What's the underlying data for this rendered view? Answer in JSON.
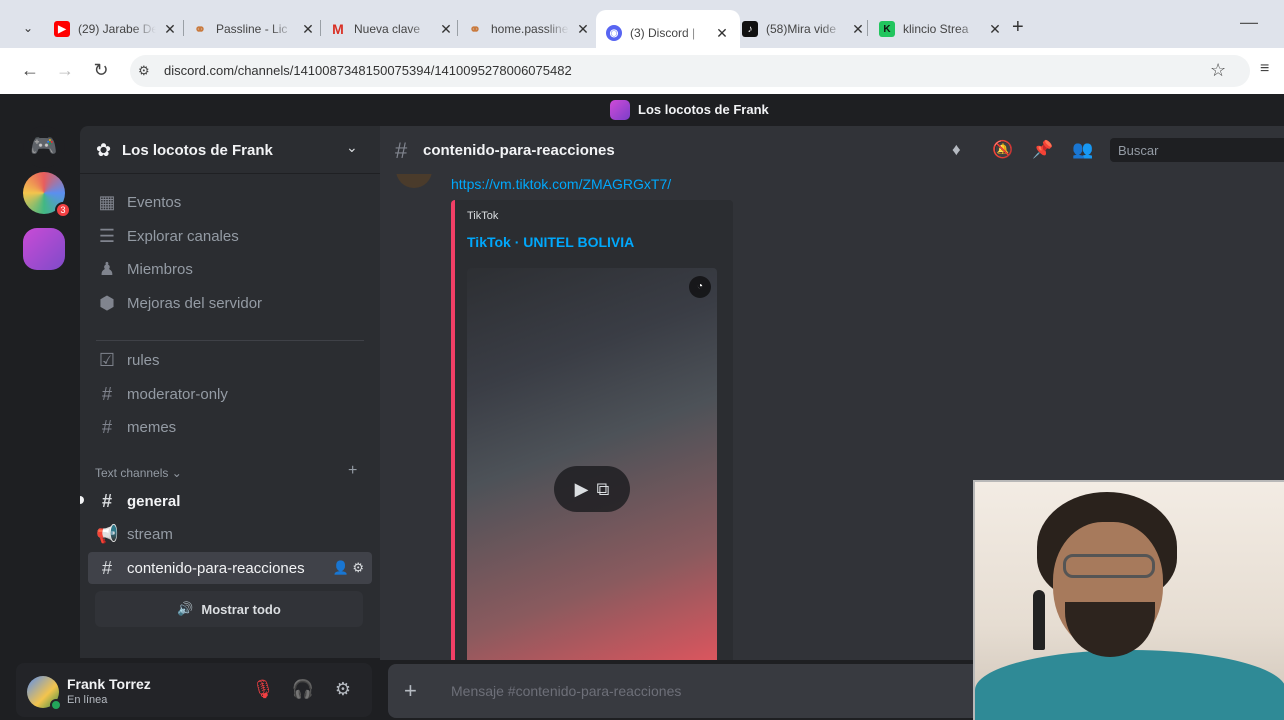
{
  "browser": {
    "tabs": [
      {
        "title": "(29) Jarabe De",
        "fav_color": "#ff0000",
        "fav_glyph": "▶"
      },
      {
        "title": "Passline - Lic",
        "fav_color": "#e8a060",
        "fav_glyph": "⚭"
      },
      {
        "title": "Nueva clave",
        "fav_color": "#ffffff",
        "fav_glyph": "M"
      },
      {
        "title": "home.passline",
        "fav_color": "#e8a060",
        "fav_glyph": "⚭"
      },
      {
        "title": "(3) Discord |",
        "fav_color": "#5865f2",
        "fav_glyph": "◉"
      },
      {
        "title": "(58)Mira vide",
        "fav_color": "#111111",
        "fav_glyph": "♪"
      },
      {
        "title": "klincio Strea",
        "fav_color": "#22c55e",
        "fav_glyph": "K"
      }
    ],
    "url": "discord.com/channels/1410087348150075394/1410095278006075482"
  },
  "app_title": "Los locotos de Frank",
  "server": {
    "name": "Los locotos de Frank",
    "nav": [
      {
        "label": "Eventos",
        "icon": "calendar-icon",
        "glyph": "▦"
      },
      {
        "label": "Explorar canales",
        "icon": "browse-channels-icon",
        "glyph": "☰"
      },
      {
        "label": "Miembros",
        "icon": "members-icon",
        "glyph": "👥"
      },
      {
        "label": "Mejoras del servidor",
        "icon": "boost-icon",
        "glyph": "⬢"
      }
    ],
    "channels_top": [
      "rules",
      "moderator-only",
      "memes"
    ],
    "category": "Text channels",
    "channels": [
      "general",
      "stream",
      "contenido-para-reacciones"
    ],
    "show_all": "Mostrar todo"
  },
  "user": {
    "name": "Frank Torrez",
    "status": "En línea"
  },
  "channel": {
    "name": "contenido-para-reacciones",
    "search_placeholder": "Buscar"
  },
  "message": {
    "link": "https://vm.tiktok.com/ZMAGRGxT7/",
    "embed_provider": "TikTok",
    "embed_title": "TikTok · UNITEL BOLIVIA"
  },
  "composer": {
    "placeholder": "Mensaje #contenido-para-reacciones"
  },
  "colors": {
    "accent_link": "#00a8fc",
    "embed_bar": "#f23f66",
    "online": "#23a55a",
    "muted": "#f23f42"
  }
}
